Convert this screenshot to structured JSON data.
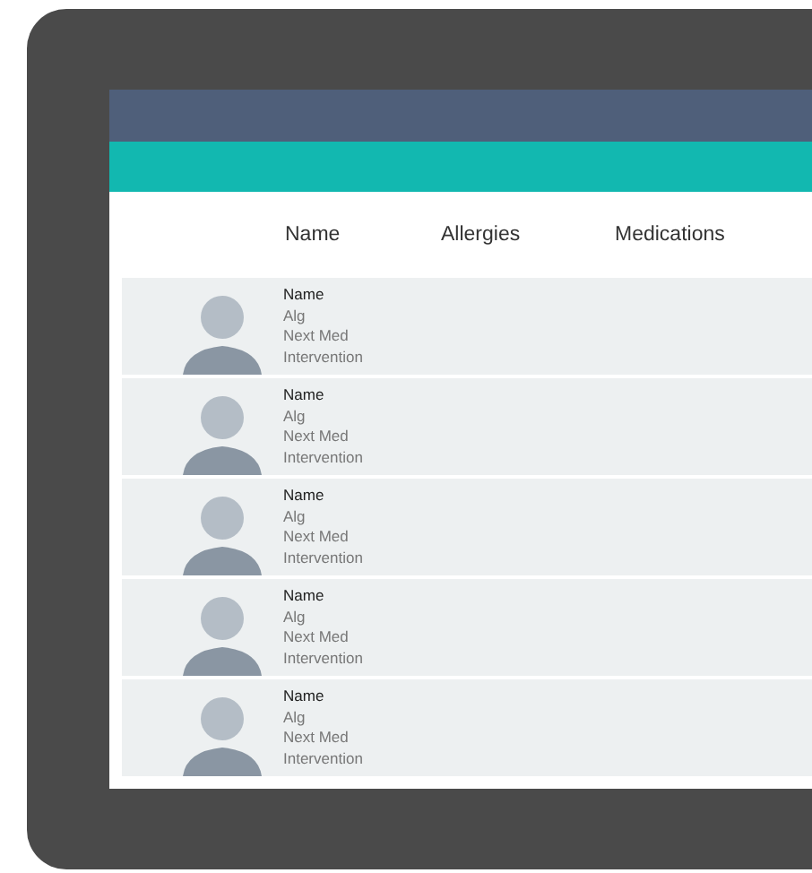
{
  "columns": [
    "Name",
    "Allergies",
    "Medications"
  ],
  "patients": [
    {
      "name": "Name",
      "allergies": "Alg",
      "next_med": "Next Med",
      "intervention": "Intervention"
    },
    {
      "name": "Name",
      "allergies": "Alg",
      "next_med": "Next Med",
      "intervention": "Intervention"
    },
    {
      "name": "Name",
      "allergies": "Alg",
      "next_med": "Next Med",
      "intervention": "Intervention"
    },
    {
      "name": "Name",
      "allergies": "Alg",
      "next_med": "Next Med",
      "intervention": "Intervention"
    },
    {
      "name": "Name",
      "allergies": "Alg",
      "next_med": "Next Med",
      "intervention": "Intervention"
    }
  ]
}
